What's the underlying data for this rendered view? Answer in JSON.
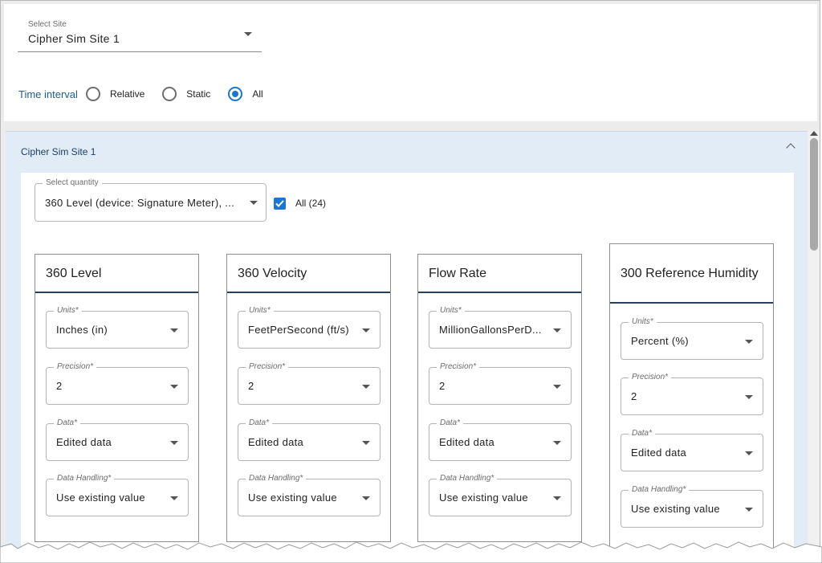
{
  "filters": {
    "site_label": "Select Site",
    "site_value": "Cipher Sim Site 1",
    "time_interval_label": "Time interval",
    "time_options": [
      {
        "label": "Relative",
        "selected": false
      },
      {
        "label": "Static",
        "selected": false
      },
      {
        "label": "All",
        "selected": true
      }
    ]
  },
  "accordion": {
    "title": "Cipher Sim Site 1",
    "quantity_label": "Select quantity",
    "quantity_value": "360 Level (device: Signature Meter), ...",
    "all_checked": true,
    "all_label": "All (24)"
  },
  "cards": [
    {
      "title": "360 Level",
      "units_label": "Units*",
      "units_value": "Inches (in)",
      "precision_label": "Precision*",
      "precision_value": "2",
      "data_label": "Data*",
      "data_value": "Edited data",
      "handling_label": "Data Handling*",
      "handling_value": "Use existing value"
    },
    {
      "title": "360 Velocity",
      "units_label": "Units*",
      "units_value": "FeetPerSecond (ft/s)",
      "precision_label": "Precision*",
      "precision_value": "2",
      "data_label": "Data*",
      "data_value": "Edited data",
      "handling_label": "Data Handling*",
      "handling_value": "Use existing value"
    },
    {
      "title": "Flow Rate",
      "units_label": "Units*",
      "units_value": "MillionGallonsPerD...",
      "precision_label": "Precision*",
      "precision_value": "2",
      "data_label": "Data*",
      "data_value": "Edited data",
      "handling_label": "Data Handling*",
      "handling_value": "Use existing value"
    },
    {
      "title": "300 Reference Humidity",
      "units_label": "Units*",
      "units_value": "Percent (%)",
      "precision_label": "Precision*",
      "precision_value": "2",
      "data_label": "Data*",
      "data_value": "Edited data",
      "handling_label": "Data Handling*",
      "handling_value": "Use existing value"
    }
  ],
  "colors": {
    "accent": "#1976d2",
    "accordion_bg": "#e1ecf6",
    "card_title_underline": "#2a3e5c"
  }
}
